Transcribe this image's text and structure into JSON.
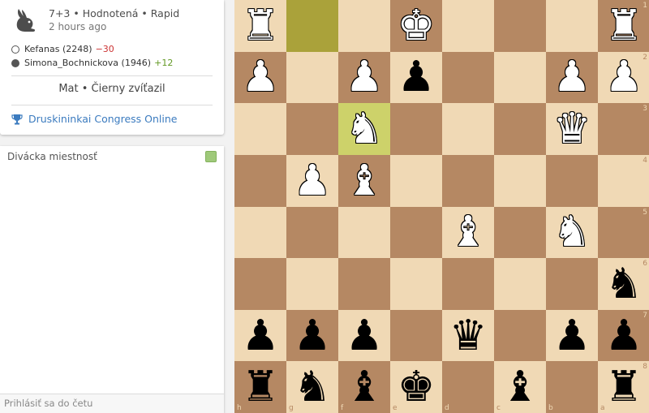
{
  "game": {
    "meta": "7+3 • Hodnotená • Rapid",
    "time_ago": "2 hours ago",
    "white_player": {
      "name": "Kefanas (2248)",
      "diff": "−30"
    },
    "black_player": {
      "name": "Simona_Bochnickova (1946)",
      "diff": "+12"
    },
    "result": "Mat • Čierny zvíťazil",
    "tournament": "Druskininkai Congress Online"
  },
  "chat": {
    "title": "Divácka miestnosť",
    "placeholder": "Prihlásiť sa do četu"
  },
  "board": {
    "ranks": [
      "1",
      "2",
      "3",
      "4",
      "5",
      "6",
      "7",
      "8"
    ],
    "files": [
      "h",
      "g",
      "f",
      "e",
      "d",
      "c",
      "b",
      "a"
    ],
    "rows": [
      [
        "wR",
        "",
        "",
        "wK",
        "",
        "",
        "",
        "wR"
      ],
      [
        "wP",
        "",
        "wP",
        "bP",
        "",
        "",
        "wP",
        "wP"
      ],
      [
        "",
        "",
        "wN",
        "",
        "",
        "",
        "wQ",
        ""
      ],
      [
        "",
        "wP",
        "wB",
        "",
        "",
        "",
        "",
        ""
      ],
      [
        "",
        "",
        "",
        "",
        "wB",
        "",
        "wN",
        ""
      ],
      [
        "",
        "",
        "",
        "",
        "",
        "",
        "",
        "bN"
      ],
      [
        "bP",
        "bP",
        "bP",
        "",
        "bQ",
        "",
        "bP",
        "bP"
      ],
      [
        "bR",
        "bN",
        "bB",
        "bK",
        "",
        "bB",
        "",
        "bR"
      ]
    ],
    "highlights": [
      "r0c1",
      "r2c2"
    ],
    "colors": {
      "light": "#f0d9b5",
      "dark": "#b58863",
      "hl_light": "#cdd26a",
      "hl_dark": "#aaa23a"
    }
  }
}
